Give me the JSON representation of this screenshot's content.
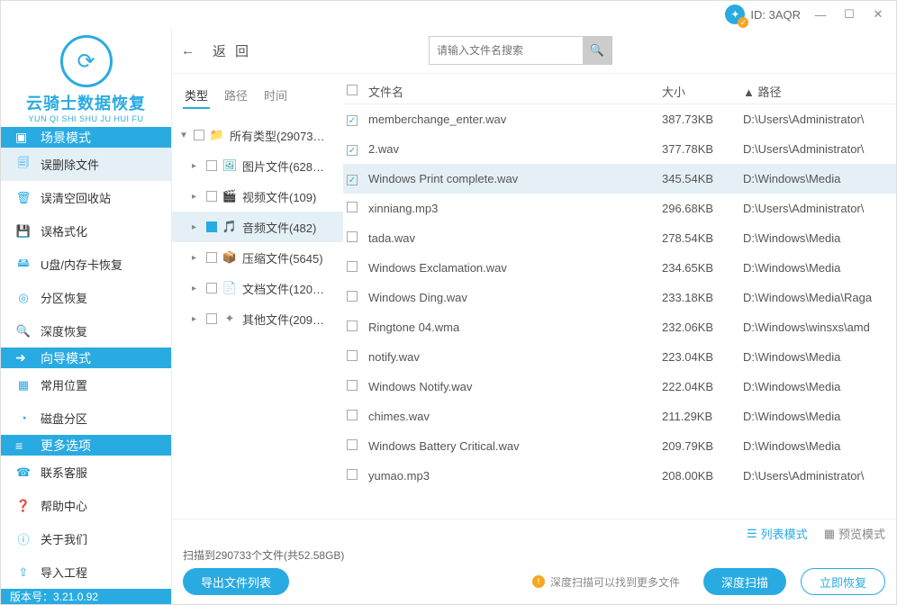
{
  "titlebar": {
    "id_label": "ID: 3AQR"
  },
  "logo": {
    "title": "云骑士数据恢复",
    "sub": "YUN QI SHI SHU JU HUI FU"
  },
  "nav": {
    "scene_header": "场景模式",
    "scene_items": [
      "误删除文件",
      "误清空回收站",
      "误格式化",
      "U盘/内存卡恢复",
      "分区恢复",
      "深度恢复"
    ],
    "wizard_header": "向导模式",
    "wizard_items": [
      "常用位置",
      "磁盘分区"
    ],
    "more_header": "更多选项",
    "more_items": [
      "联系客服",
      "帮助中心",
      "关于我们",
      "导入工程"
    ]
  },
  "version": "版本号：3.21.0.92",
  "back_label": "返回",
  "search_placeholder": "请输入文件名搜索",
  "tree_tabs": {
    "type": "类型",
    "path": "路径",
    "time": "时间"
  },
  "tree": {
    "root": "所有类型(29073…",
    "children": [
      {
        "label": "图片文件(628…",
        "icon": "image"
      },
      {
        "label": "视频文件(109)",
        "icon": "video"
      },
      {
        "label": "音频文件(482)",
        "icon": "audio",
        "selected": true,
        "checked": true
      },
      {
        "label": "压缩文件(5645)",
        "icon": "archive"
      },
      {
        "label": "文档文件(120…",
        "icon": "doc"
      },
      {
        "label": "其他文件(209…",
        "icon": "other"
      }
    ]
  },
  "table": {
    "hdr_name": "文件名",
    "hdr_size": "大小",
    "hdr_path": "▲ 路径",
    "rows": [
      {
        "c": true,
        "n": "memberchange_enter.wav",
        "s": "387.73KB",
        "p": "D:\\Users\\Administrator\\"
      },
      {
        "c": true,
        "n": "2.wav",
        "s": "377.78KB",
        "p": "D:\\Users\\Administrator\\"
      },
      {
        "c": true,
        "sel": true,
        "n": "Windows Print complete.wav",
        "s": "345.54KB",
        "p": "D:\\Windows\\Media"
      },
      {
        "c": false,
        "n": "xinniang.mp3",
        "s": "296.68KB",
        "p": "D:\\Users\\Administrator\\"
      },
      {
        "c": false,
        "n": "tada.wav",
        "s": "278.54KB",
        "p": "D:\\Windows\\Media"
      },
      {
        "c": false,
        "n": "Windows Exclamation.wav",
        "s": "234.65KB",
        "p": "D:\\Windows\\Media"
      },
      {
        "c": false,
        "n": "Windows Ding.wav",
        "s": "233.18KB",
        "p": "D:\\Windows\\Media\\Raga"
      },
      {
        "c": false,
        "n": "Ringtone 04.wma",
        "s": "232.06KB",
        "p": "D:\\Windows\\winsxs\\amd"
      },
      {
        "c": false,
        "n": "notify.wav",
        "s": "223.04KB",
        "p": "D:\\Windows\\Media"
      },
      {
        "c": false,
        "n": "Windows Notify.wav",
        "s": "222.04KB",
        "p": "D:\\Windows\\Media"
      },
      {
        "c": false,
        "n": "chimes.wav",
        "s": "211.29KB",
        "p": "D:\\Windows\\Media"
      },
      {
        "c": false,
        "n": "Windows Battery Critical.wav",
        "s": "209.79KB",
        "p": "D:\\Windows\\Media"
      },
      {
        "c": false,
        "n": "yumao.mp3",
        "s": "208.00KB",
        "p": "D:\\Users\\Administrator\\"
      }
    ]
  },
  "footer": {
    "list_mode": "列表模式",
    "preview_mode": "预览模式",
    "summary": "扫描到290733个文件(共52.58GB)",
    "export": "导出文件列表",
    "hint": "深度扫描可以找到更多文件",
    "deep_scan": "深度扫描",
    "recover": "立即恢复"
  }
}
